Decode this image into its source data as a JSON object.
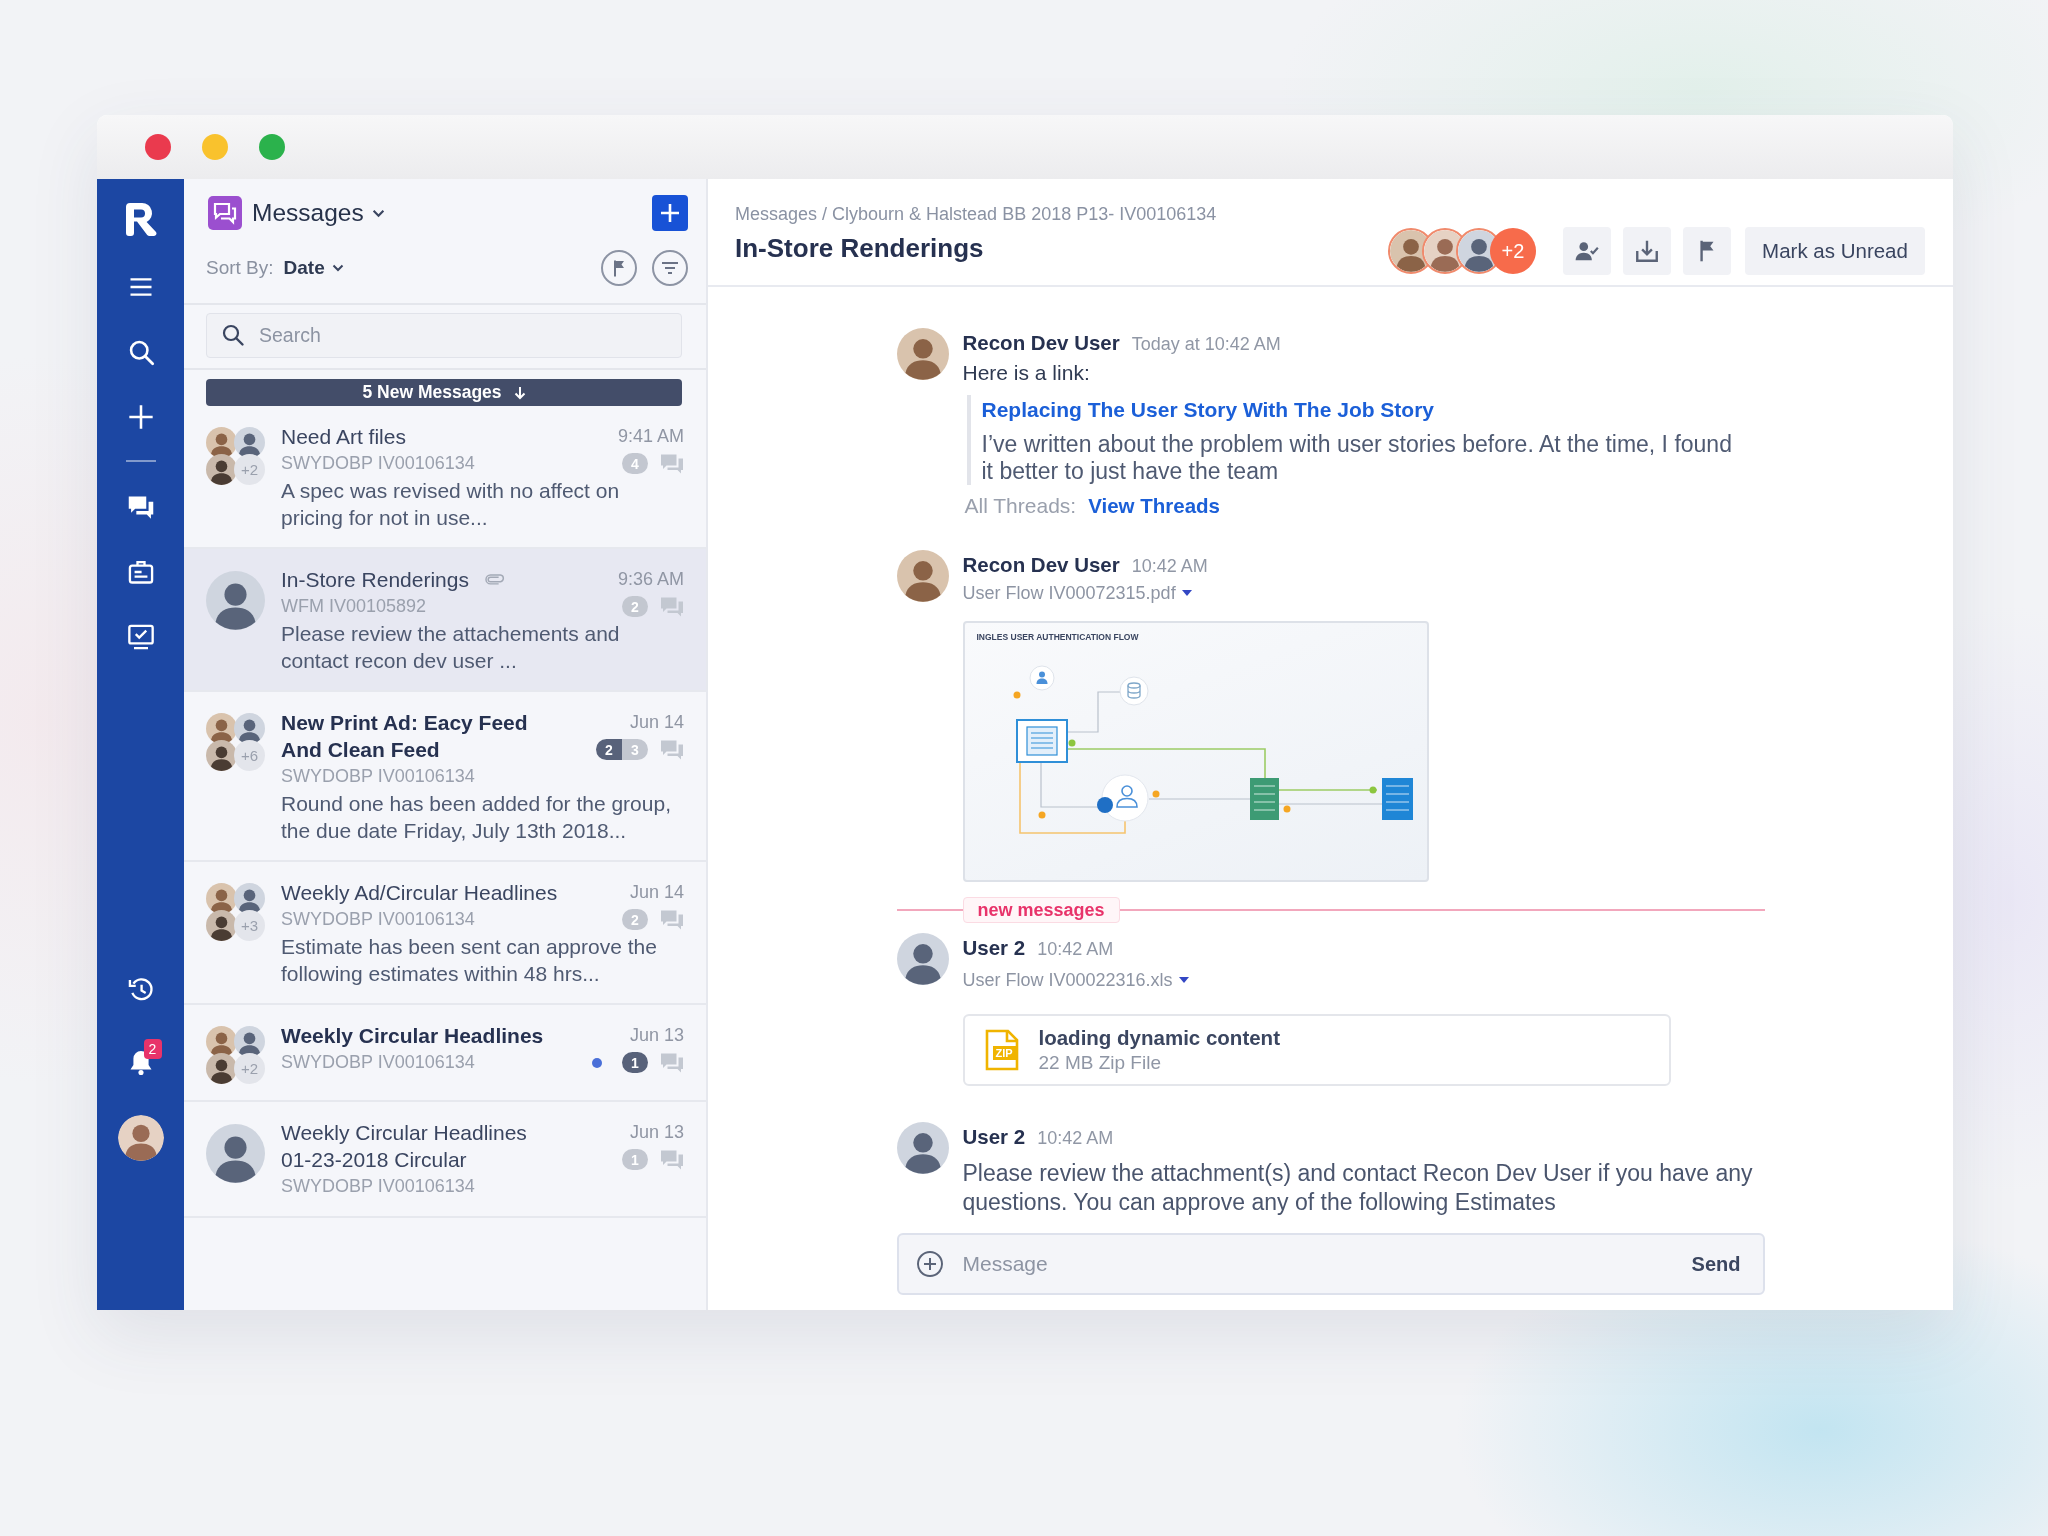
{
  "rail": {
    "notification_count": "2"
  },
  "list_panel": {
    "title": "Messages",
    "sort_label": "Sort By:",
    "sort_value": "Date",
    "search": {
      "placeholder": "Search"
    },
    "new_messages_banner": "5 New Messages",
    "threads": [
      {
        "title": "Need Art files",
        "unread": false,
        "selected": false,
        "attachment": false,
        "dot": false,
        "time": "9:41 AM",
        "code": "SWYDOBP IV00106134",
        "preview": "A spec was revised with no affect on pricing for not in use...",
        "avatars": {
          "kind": "group",
          "more": "+2"
        },
        "counts": [
          {
            "value": "4",
            "unread": false
          }
        ]
      },
      {
        "title": "In-Store Renderings",
        "unread": false,
        "selected": true,
        "attachment": true,
        "dot": false,
        "time": "9:36 AM",
        "code": "WFM IV00105892",
        "preview": "Please review the attachements and contact recon dev user ...",
        "avatars": {
          "kind": "single"
        },
        "counts": [
          {
            "value": "2",
            "unread": false
          }
        ]
      },
      {
        "title": "New Print Ad: Eacy Feed And Clean Feed",
        "unread": true,
        "selected": false,
        "attachment": false,
        "dot": false,
        "time": "Jun 14",
        "code": "SWYDOBP IV00106134",
        "preview": "Round one has been added for the group, the due date Friday, July 13th 2018...",
        "avatars": {
          "kind": "group",
          "more": "+6"
        },
        "counts": [
          {
            "value": "2",
            "unread": true
          },
          {
            "value": "3",
            "unread": false
          }
        ]
      },
      {
        "title": "Weekly Ad/Circular Headlines",
        "unread": false,
        "selected": false,
        "attachment": false,
        "dot": false,
        "time": "Jun 14",
        "code": "SWYDOBP IV00106134",
        "preview": "Estimate has been sent can approve the following estimates within 48 hrs...",
        "avatars": {
          "kind": "group",
          "more": "+3"
        },
        "counts": [
          {
            "value": "2",
            "unread": false
          }
        ]
      },
      {
        "title": "Weekly Circular Headlines",
        "unread": true,
        "selected": false,
        "attachment": false,
        "dot": true,
        "time": "Jun 13",
        "code": "SWYDOBP IV00106134",
        "avatars": {
          "kind": "group",
          "more": "+2"
        },
        "counts": [
          {
            "value": "1",
            "unread": true
          }
        ]
      },
      {
        "title": "Weekly Circular Headlines 01-23-2018 Circular",
        "unread": false,
        "selected": false,
        "attachment": false,
        "dot": false,
        "time": "Jun 13",
        "code": "SWYDOBP IV00106134",
        "avatars": {
          "kind": "single"
        },
        "counts": [
          {
            "value": "1",
            "unread": false
          }
        ]
      }
    ]
  },
  "conversation": {
    "breadcrumb": "Messages / Clybourn & Halstead BB 2018 P13- IV00106134",
    "title": "In-Store Renderings",
    "more_participants": "+2",
    "mark_unread": "Mark as Unread",
    "messages": [
      {
        "kind": "link",
        "author": "Recon Dev User",
        "time": "Today at 10:42 AM",
        "text": "Here is a link:",
        "link_title": "Replacing The User Story With The Job Story",
        "link_excerpt": "I’ve written about the problem with user stories before. At the time, I found it better to just have the team",
        "threads_label": "All Threads:",
        "threads_link": "View Threads"
      },
      {
        "kind": "image",
        "author": "Recon Dev User",
        "time": "10:42 AM",
        "file_name": "User Flow IV00072315.pdf",
        "preview_title": "INGLES USER AUTHENTICATION FLOW"
      },
      {
        "kind": "divider",
        "label": "new messages"
      },
      {
        "kind": "file",
        "author": "User 2",
        "time": "10:42 AM",
        "file_name": "User Flow IV00022316.xls",
        "file_type": "ZIP",
        "file_title": "loading dynamic content",
        "file_meta": "22 MB Zip File"
      },
      {
        "kind": "text",
        "author": "User 2",
        "time": "10:42 AM",
        "text": "Please review the attachment(s) and contact Recon Dev User if you have any questions. You can approve any of the following Estimates"
      }
    ],
    "composer": {
      "placeholder": "Message",
      "send": "Send"
    }
  }
}
